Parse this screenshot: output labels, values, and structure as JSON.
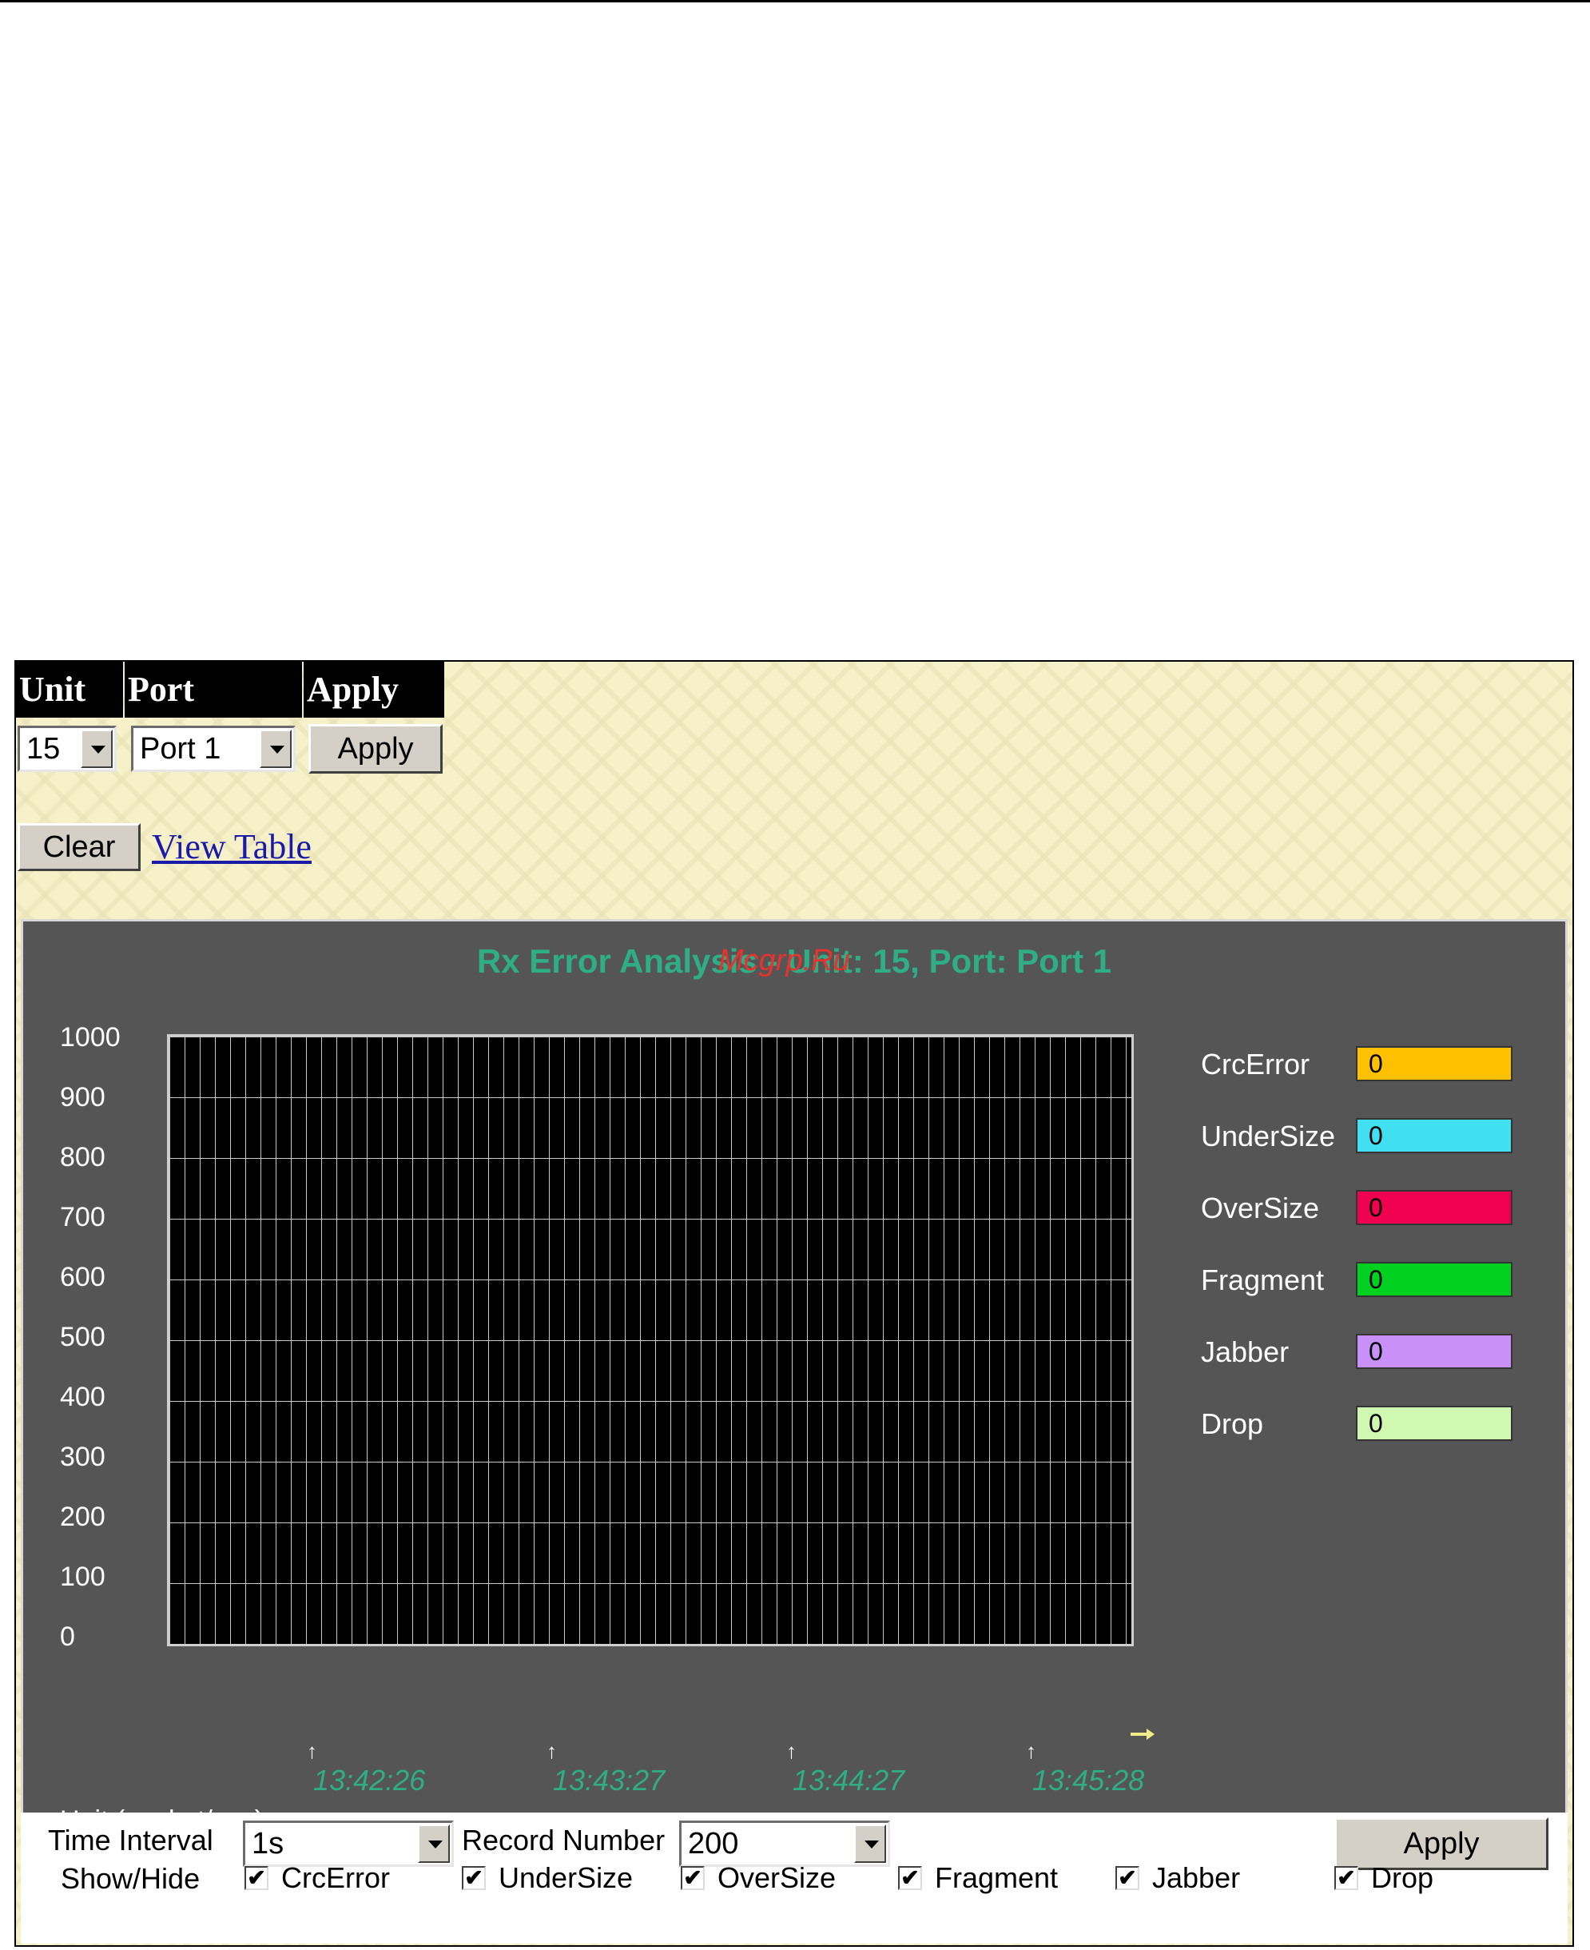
{
  "header": {
    "unit_label": "Unit",
    "port_label": "Port",
    "apply_label": "Apply"
  },
  "selectors": {
    "unit_value": "15",
    "port_value": "Port 1",
    "apply_button": "Apply"
  },
  "actions": {
    "clear_button": "Clear",
    "view_table_link": "View Table"
  },
  "chart": {
    "title": "Rx Error Analysis - Unit: 15, Port: Port 1",
    "watermark": "Mcgrp.Ru",
    "unit_label": "Unit:(packet/sec)",
    "y_ticks": [
      "1000",
      "900",
      "800",
      "700",
      "600",
      "500",
      "400",
      "300",
      "200",
      "100",
      "0"
    ],
    "time_marks": [
      "↑",
      "↑",
      "↑",
      "↑"
    ],
    "x_ticks": [
      "13:42:26",
      "13:43:27",
      "13:44:27",
      "13:45:28"
    ],
    "legend": [
      {
        "name": "CrcError",
        "value": "0",
        "color": "#ffc000"
      },
      {
        "name": "UnderSize",
        "value": "0",
        "color": "#40e0f0"
      },
      {
        "name": "OverSize",
        "value": "0",
        "color": "#f00050"
      },
      {
        "name": "Fragment",
        "value": "0",
        "color": "#00d020"
      },
      {
        "name": "Jabber",
        "value": "0",
        "color": "#c890f8"
      },
      {
        "name": "Drop",
        "value": "0",
        "color": "#d0f8b0"
      }
    ]
  },
  "chart_data": {
    "type": "line",
    "title": "Rx Error Analysis - Unit: 15, Port: Port 1",
    "ylabel": "Unit:(packet/sec)",
    "ylim": [
      0,
      1000
    ],
    "x": [
      "13:42:26",
      "13:43:27",
      "13:44:27",
      "13:45:28"
    ],
    "series": [
      {
        "name": "CrcError",
        "values": [
          0,
          0,
          0,
          0
        ]
      },
      {
        "name": "UnderSize",
        "values": [
          0,
          0,
          0,
          0
        ]
      },
      {
        "name": "OverSize",
        "values": [
          0,
          0,
          0,
          0
        ]
      },
      {
        "name": "Fragment",
        "values": [
          0,
          0,
          0,
          0
        ]
      },
      {
        "name": "Jabber",
        "values": [
          0,
          0,
          0,
          0
        ]
      },
      {
        "name": "Drop",
        "values": [
          0,
          0,
          0,
          0
        ]
      }
    ],
    "grid": true,
    "legend": "right"
  },
  "controls": {
    "time_interval_label": "Time Interval",
    "time_interval_value": "1s",
    "record_number_label": "Record Number",
    "record_number_value": "200",
    "apply_button": "Apply",
    "show_hide_label": "Show/Hide",
    "checkboxes": [
      {
        "label": "CrcError",
        "mark": "✔"
      },
      {
        "label": "UnderSize",
        "mark": "✔"
      },
      {
        "label": "OverSize",
        "mark": "✔"
      },
      {
        "label": "Fragment",
        "mark": "✔"
      },
      {
        "label": "Jabber",
        "mark": "✔"
      },
      {
        "label": "Drop",
        "mark": "✔"
      }
    ]
  }
}
